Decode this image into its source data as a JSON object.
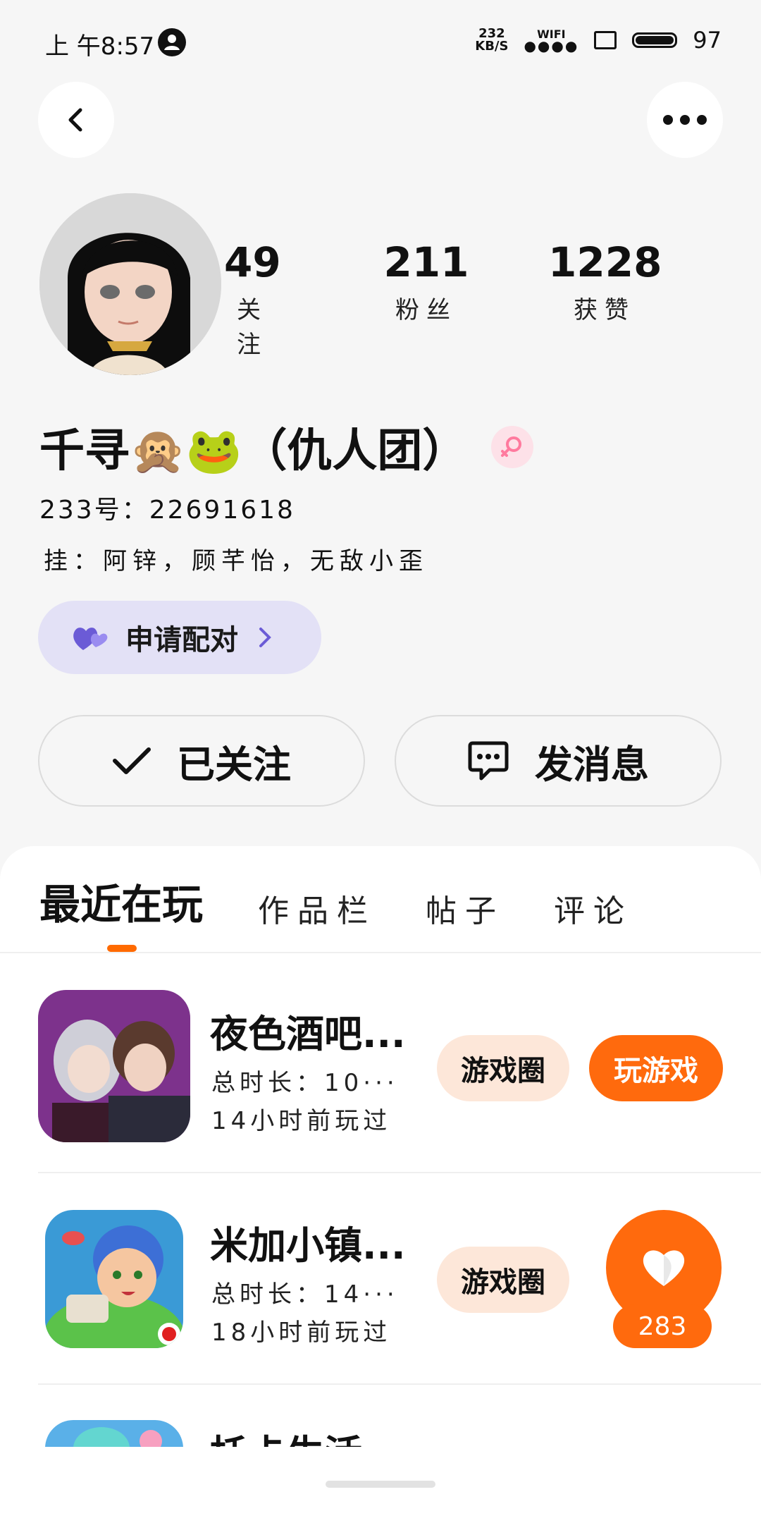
{
  "status_bar": {
    "time": "上 午8:57",
    "net_top": "232",
    "net_bottom": "KB/S",
    "wifi": "WIFI",
    "battery": "97"
  },
  "profile": {
    "stats": [
      {
        "value": "49",
        "label": "关注"
      },
      {
        "value": "211",
        "label": "粉丝"
      },
      {
        "value": "1228",
        "label": "获赞"
      }
    ],
    "name": "千寻🙊🐸（仇人团）",
    "uid": "233号：22691618",
    "hang": "挂：阿锌，顾芊怡，无敌小歪",
    "pair_label": "申请配对",
    "follow_label": "已关注",
    "message_label": "发消息"
  },
  "tabs": [
    {
      "label": "最近在玩",
      "active": true
    },
    {
      "label": "作品栏",
      "active": false
    },
    {
      "label": "帖子",
      "active": false
    },
    {
      "label": "评论",
      "active": false
    }
  ],
  "games": [
    {
      "title": "夜色酒吧...",
      "duration": "总时长：10···",
      "last_played": "14小时前玩过",
      "circle_label": "游戏圈",
      "play_label": "玩游戏"
    },
    {
      "title": "米加小镇...",
      "duration": "总时长：14···",
      "last_played": "18小时前玩过",
      "circle_label": "游戏圈"
    },
    {
      "title": "托卡生活"
    }
  ],
  "like_badge": {
    "count": "283"
  },
  "colors": {
    "accent": "#ff6a0d",
    "pair_bg": "#e3e1f6",
    "circle_bg": "#fde7d9",
    "gender_bg": "#fde1e8",
    "heart": "#6b5bd6"
  }
}
